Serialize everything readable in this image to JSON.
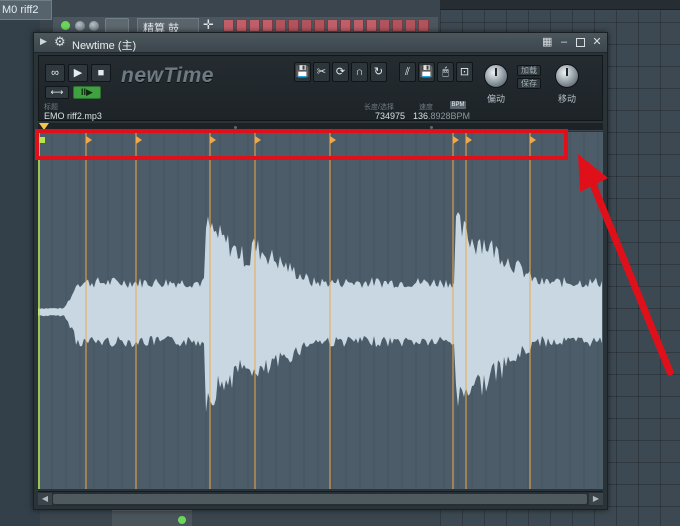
{
  "host": {
    "top_tab_label": "M0 riff2",
    "channel_name": "精算 鼓",
    "channel_step_count": 16,
    "colors": {
      "step_active": "#c05f68",
      "led_green": "#6cd65a"
    }
  },
  "window": {
    "title": "Newtime (主)",
    "controls": {
      "keyboard": "keyboard-icon",
      "minimize": "minimize-icon",
      "maximize": "maximize-icon",
      "close": "close-icon"
    }
  },
  "toolbar": {
    "loop_glyph": "∞",
    "play_glyph": "▶",
    "stop_glyph": "■",
    "link_glyph": "⟷",
    "active_toggle_glyph": "II▶",
    "logo": "newTime",
    "tools_left": [
      "💾",
      "✂",
      "⟳",
      "∩",
      "↻"
    ],
    "tools_left_icons": [
      "save-icon",
      "cut-icon",
      "loop-region-icon",
      "magnet-icon",
      "refresh-icon"
    ],
    "tools_right": [
      "⫽",
      "💾",
      "🖱",
      "⊡"
    ],
    "tools_right_icons": [
      "slice-icon",
      "save-slices-icon",
      "pointer-icon",
      "export-icon"
    ],
    "knob_left_label": "偏动",
    "load_label": "加载",
    "save_label": "保存",
    "knob_right_label": "移动"
  },
  "file": {
    "caption": "标题",
    "name": "EMO riff2.mp3"
  },
  "stats": {
    "length_caption": "长度/选择",
    "length_value": "734975",
    "tempo_caption": "速度",
    "tempo_value_main": "136",
    "tempo_value_dim": ".8928BPM",
    "bpm_badge": "BPM"
  },
  "markers": {
    "slice_positions": [
      0.085,
      0.173,
      0.305,
      0.384,
      0.517,
      0.735,
      0.758,
      0.871
    ],
    "colors": {
      "marker": "#f0a848",
      "first_marker": "#b7e64a",
      "annotation": "#e0101a",
      "wave_fill": "#c8d7e2",
      "wave_bg": "#4c5d69"
    }
  }
}
